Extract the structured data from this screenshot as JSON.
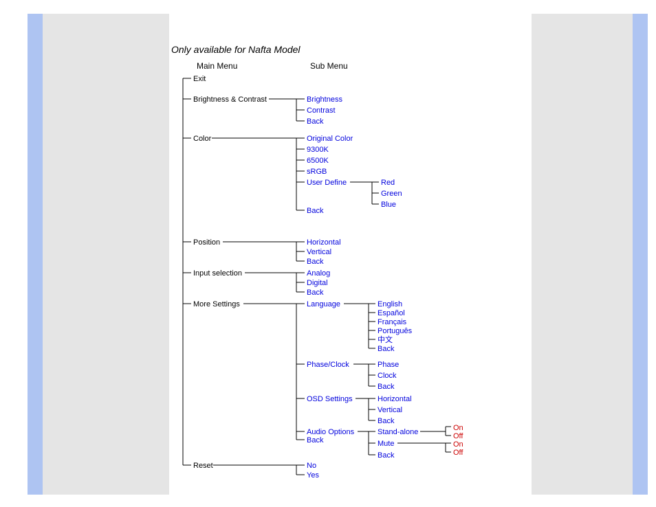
{
  "title": "Only available for Nafta Model",
  "headers": {
    "main": "Main Menu",
    "sub": "Sub Menu"
  },
  "menu": {
    "exit": "Exit",
    "brightness_contrast": {
      "label": "Brightness & Contrast",
      "brightness": "Brightness",
      "contrast": "Contrast",
      "back": "Back"
    },
    "color": {
      "label": "Color",
      "original": "Original Color",
      "k9300": "9300K",
      "k6500": "6500K",
      "srgb": "sRGB",
      "user_define": {
        "label": "User Define",
        "red": "Red",
        "green": "Green",
        "blue": "Blue"
      },
      "back": "Back"
    },
    "position": {
      "label": "Position",
      "horizontal": "Horizontal",
      "vertical": "Vertical",
      "back": "Back"
    },
    "input_selection": {
      "label": "Input selection",
      "analog": "Analog",
      "digital": "Digital",
      "back": "Back"
    },
    "more_settings": {
      "label": "More Settings",
      "language": {
        "label": "Language",
        "english": "English",
        "espanol": "Español",
        "francais": "Français",
        "portugues": "Português",
        "chinese": "中文",
        "back": "Back"
      },
      "phase_clock": {
        "label": "Phase/Clock",
        "phase": "Phase",
        "clock": "Clock",
        "back": "Back"
      },
      "osd_settings": {
        "label": "OSD Settings",
        "horizontal": "Horizontal",
        "vertical": "Vertical",
        "back": "Back"
      },
      "audio_options": {
        "label": "Audio Options",
        "stand_alone": {
          "label": "Stand-alone",
          "on": "On",
          "off": "Off"
        },
        "mute": {
          "label": "Mute",
          "on": "On",
          "off": "Off"
        },
        "back": "Back"
      },
      "back": "Back"
    },
    "reset": {
      "label": "Reset",
      "no": "No",
      "yes": "Yes"
    }
  }
}
